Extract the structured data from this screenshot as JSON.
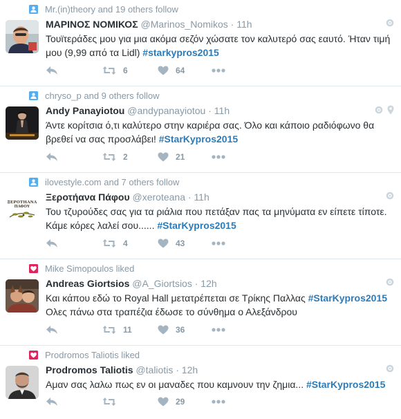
{
  "tweets": [
    {
      "context": {
        "type": "follow",
        "text": "Mr.(in)theory and 19 others follow"
      },
      "name": "ΜΑΡΙΝΟΣ ΝΟΜΙΚΟΣ",
      "handle": "@Marinos_Nomikos",
      "dot": "·",
      "time": "11h",
      "text": "Τουϊτεράδες μου για μια ακόμα σεζόν χώσατε τον καλυτερό σας εαυτό. Ήταν τιμή μου (9,99 από τα Lidl) ",
      "hashtag": "#starkypros2015",
      "text_after": "",
      "retweets": "6",
      "likes": "64",
      "location": false
    },
    {
      "context": {
        "type": "follow",
        "text": "chryso_p and 9 others follow"
      },
      "name": "Andy Panayiotou",
      "handle": "@andypanayiotou",
      "dot": "·",
      "time": "11h",
      "text": "Άντε κορίτσια ό,τι καλύτερο στην καριέρα σας. Όλο και κάποιο ραδιόφωνο θα βρεθεί να σας προσλάβει! ",
      "hashtag": "#StarKypros2015",
      "text_after": "",
      "retweets": "2",
      "likes": "21",
      "location": true
    },
    {
      "context": {
        "type": "follow",
        "text": "ilovestyle.com and 7 others follow"
      },
      "name": "Ξεροτήανα Πάφου",
      "handle": "@xeroteana",
      "dot": "·",
      "time": "11h",
      "text": "Του τζυρούδες σας για τα ριάλια που πετάξαν πας τα μηνύματα εν είπετε τίποτε. Κάμε κόρες λαλεί σου...... ",
      "hashtag": "#StarKypros2015",
      "text_after": "",
      "retweets": "4",
      "likes": "43",
      "location": false,
      "avatar_text_1": "ΞΕΡΟΤΗΑΝΑ",
      "avatar_text_2": "ΠΑΦΟΥ"
    },
    {
      "context": {
        "type": "like",
        "text": "Mike Simopoulos liked"
      },
      "name": "Andreas Giortsios",
      "handle": "@A_Giortsios",
      "dot": "·",
      "time": "12h",
      "text": "Και κάπου εδώ το Royal Hall μετατρέπεται σε Τρίκης Παλλας ",
      "hashtag": "#StarKypros2015",
      "text_after": " Ολες πάνω στα τραπέζια έδωσε το σύνθημα ο Αλεξάνδρου",
      "retweets": "11",
      "likes": "36",
      "location": false
    },
    {
      "context": {
        "type": "like",
        "text": "Prodromos Taliotis liked"
      },
      "name": "Prodromos Taliotis",
      "handle": "@taliotis",
      "dot": "·",
      "time": "12h",
      "text": "Αμαν σας λαλω πως εν οι μαναδες που καμνουν την ζημια... ",
      "hashtag": "#StarKypros2015",
      "text_after": "",
      "retweets": "",
      "likes": "29",
      "location": false
    }
  ],
  "colors": {
    "link": "#2b7bb9",
    "muted": "#8899a6",
    "follow_icon": "#55acee",
    "like_icon": "#e0245e",
    "border": "#e1e8ed"
  },
  "icons": {
    "reply": "reply-icon",
    "retweet": "retweet-icon",
    "like": "heart-icon",
    "more": "more-dots-icon",
    "follow": "person-follow-icon",
    "liked": "heart-filled-icon",
    "globe": "globe-icon",
    "location": "location-pin-icon"
  }
}
